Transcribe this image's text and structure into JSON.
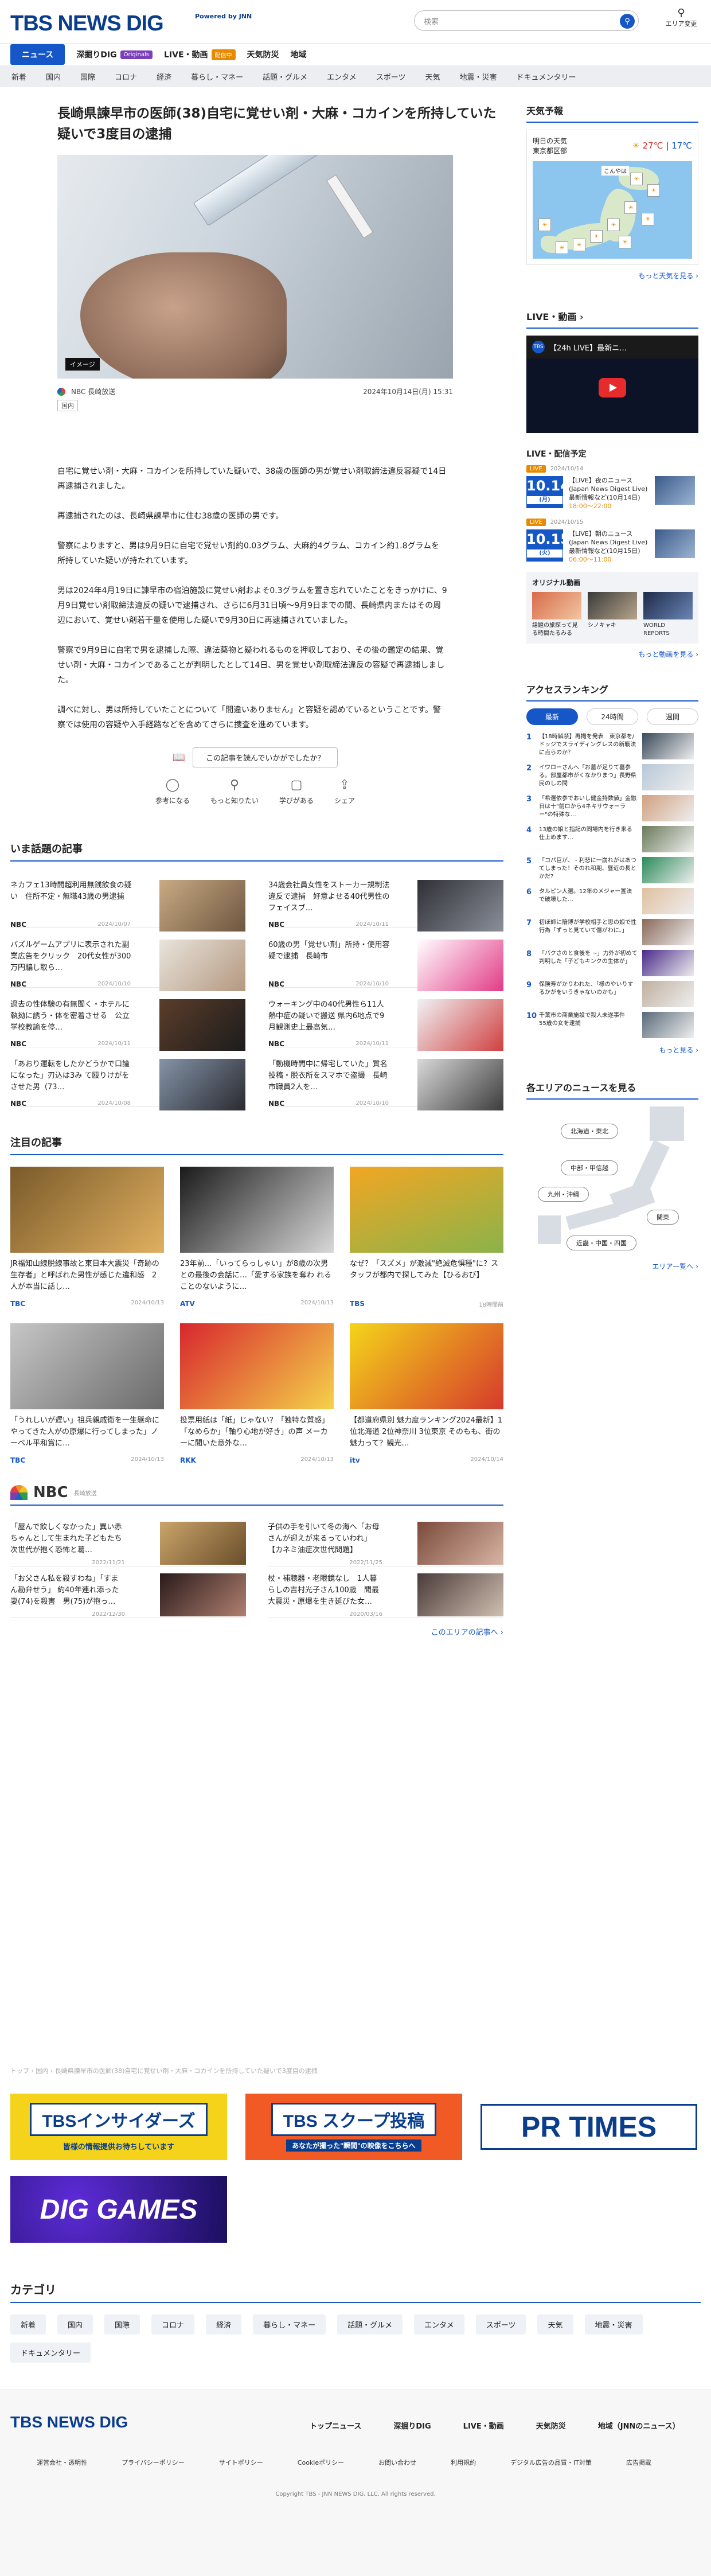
{
  "header": {
    "logo": "TBS NEWS DIG",
    "powered": "Powered by JNN",
    "search_placeholder": "検索",
    "area_label": "エリア変更"
  },
  "nav": {
    "items": [
      {
        "label": "ニュース",
        "active": true
      },
      {
        "label": "深掘りDIG",
        "tag": "Originals"
      },
      {
        "label": "LIVE・動画",
        "tag": "配信中"
      },
      {
        "label": "天気防災"
      },
      {
        "label": "地域"
      }
    ]
  },
  "subnav": [
    "新着",
    "国内",
    "国際",
    "コロナ",
    "経済",
    "暮らし・マネー",
    "話題・グルメ",
    "エンタメ",
    "スポーツ",
    "天気",
    "地震・災害",
    "ドキュメンタリー"
  ],
  "article": {
    "title": "長崎県諫早市の医師(38)自宅に覚せい剤・大麻・コカインを所持していた疑いで3度目の逮捕",
    "image_caption": "イメージ",
    "source": "NBC 長崎放送",
    "date": "2024年10月14日(月) 15:31",
    "keyword": "国内",
    "paragraphs": [
      "自宅に覚せい剤・大麻・コカインを所持していた疑いで、38歳の医師の男が覚せい剤取締法違反容疑で14日再逮捕されました。",
      "再逮捕されたのは、長崎県諫早市に住む38歳の医師の男です。",
      "警察によりますと、男は9月9日に自宅で覚せい剤約0.03グラム、大麻約4グラム、コカイン約1.8グラムを所持していた疑いが持たれています。",
      "男は2024年4月19日に諫早市の宿泊施設に覚せい剤およそ0.3グラムを置き忘れていたことをきっかけに、9月9日覚せい剤取締法違反の疑いで逮捕され、さらに6月31日頃〜9月9日までの間、長崎県内またはその周辺において、覚せい剤若干量を使用した疑いで9月30日に再逮捕されていました。",
      "警察で9月9日に自宅で男を逮捕した際、違法薬物と疑われるものを押収しており、その後の鑑定の結果、覚せい剤・大麻・コカインであることが判明したとして14日、男を覚せい剤取締法違反の容疑で再逮捕しました。",
      "調べに対し、男は所持していたことについて「間違いありません」と容疑を認めているということです。警察では使用の容疑や入手経路などを含めてさらに捜査を進めています。"
    ],
    "rating_question": "この記事を読んでいかがでしたか？",
    "rating_items": [
      "参考になる",
      "もっと知りたい",
      "学びがある",
      "シェア"
    ]
  },
  "trending": {
    "title": "いま話題の記事",
    "items": [
      {
        "text": "ネカフェ13時間超利用無銭飲食の疑い　住所不定・無職43歳の男逮捕",
        "src": "NBC",
        "date": "2024/10/07"
      },
      {
        "text": "34歳会社員女性をストーカー規制法違反で逮捕　好意よせる40代男性のフェイスブ…",
        "src": "NBC",
        "date": "2024/10/11"
      },
      {
        "text": "パズルゲームアプリに表示された副業広告をクリック　20代女性が300万円騙し取ら…",
        "src": "NBC",
        "date": "2024/10/10"
      },
      {
        "text": "60歳の男「覚せい剤」所持・使用容疑で逮捕　長崎市",
        "src": "NBC",
        "date": "2024/10/10"
      },
      {
        "text": "過去の性体験の有無聞く・ホテルに執拗に誘う・体を密着させる　公立学校教諭を停…",
        "src": "NBC",
        "date": "2024/10/11"
      },
      {
        "text": "ウォーキング中の40代男性ら11人熱中症の疑いで搬送 県内6地点で9月観測史上最高気…",
        "src": "NBC",
        "date": "2024/10/11"
      },
      {
        "text": "「あおり運転をしたかどうかで口論になった」刃込は3み て殴りけがをさせた男（73…",
        "src": "NBC",
        "date": "2024/10/08"
      },
      {
        "text": "「動機時間中に帰宅していた」質名投稿・脱衣所をスマホで盗撮　長崎市職員2人を…",
        "src": "NBC",
        "date": "2024/10/10"
      }
    ]
  },
  "featured": {
    "title": "注目の記事",
    "items": [
      {
        "text": "JR福知山線脱線事故と東日本大震災「奇跡の生存者」と呼ばれた男性が感じた違和感　2人が本当に話し…",
        "src": "TBC",
        "date": "2024/10/13"
      },
      {
        "text": "23年前…「いってらっしゃい」が8歳の次男との最後の会話に…「愛する家族を奪わ れることのないように…",
        "src": "ATV",
        "date": "2024/10/13"
      },
      {
        "text": "なぜ？「スズメ」が激減\"絶滅危惧種\"に？スタッフが都内で探してみた【ひるおび】",
        "src": "TBS",
        "date": "18時間前"
      },
      {
        "text": "「うれしいが遅い」祖兵親戚衛を一生懸命にやってきた人がの原爆に行ってしまった」ノーベル平和賞に…",
        "src": "TBC",
        "date": "2024/10/13"
      },
      {
        "text": "投票用紙は「紙」じゃない？「独特な質感」「なめらか」「軸り心地が好き」の声 メーカーに聞いた意外な…",
        "src": "RKK",
        "date": "2024/10/13"
      },
      {
        "text": "【都道府県別 魅力度ランキング2024最新】1位北海道 2位神奈川 3位東京 そのもも、街の魅力って？観光…",
        "src": "itv",
        "date": "2024/10/14"
      }
    ]
  },
  "nbc": {
    "title": "NBC",
    "subtitle": "長崎放送",
    "items": [
      {
        "text": "「屋んで飲しくなかった」異い赤ちゃんとして生まれた子どもたち　次世代が抱く恐怖と葛…",
        "date": "2022/11/21"
      },
      {
        "text": "子供の手を引いて冬の海へ「お母さんが迎えが来るっていわれ」【カネミ油症次世代問題】",
        "date": "2022/11/25"
      },
      {
        "text": "「お父さん私を殺すわね」「すまん勘弁せう」 約40年連れ添った妻(74)を殺害　男(75)が抱っ…",
        "date": "2022/12/30"
      },
      {
        "text": "杖・補聴器・老眼鏡なし　1人暮らしの吉村光子さん100歳　聞最大震災・原爆を生き延びた女…",
        "date": "2020/03/16"
      }
    ],
    "more": "このエリアの記事へ ›"
  },
  "breadcrumb": "トップ › 国内 › 長崎県諫早市の医師(38)自宅に覚せい剤・大麻・コカインを所持していた疑いで3度目の逮捕",
  "banners": [
    {
      "label": "TBSインサイダーズ",
      "sub": "皆様の情報提供お待ちしています"
    },
    {
      "label": "TBS スクープ投稿",
      "sub": "あなたが撮った\"瞬間\"の映像をこちらへ"
    },
    {
      "label": "PR TIMES"
    },
    {
      "label": "DIG GAMES"
    }
  ],
  "categories": {
    "title": "カテゴリ",
    "items": [
      "新着",
      "国内",
      "国際",
      "コロナ",
      "経済",
      "暮らし・マネー",
      "話題・グルメ",
      "エンタメ",
      "スポーツ",
      "天気",
      "地震・災害",
      "ドキュメンタリー"
    ]
  },
  "footer": {
    "logo": "TBS NEWS DIG",
    "nav": [
      "トップニュース",
      "深掘りDIG",
      "LIVE・動画",
      "天気防災",
      "地域（JNNのニュース）"
    ],
    "links": [
      "運営会社・透明性",
      "プライバシーポリシー",
      "サイトポリシー",
      "Cookieポリシー",
      "お問い合わせ",
      "利用規約",
      "デジタル広告の品質・IT対策",
      "広告掲載"
    ],
    "copyright": "Copyright TBS - JNN NEWS DIG, LLC. All rights reserved."
  },
  "sidebar": {
    "weather": {
      "title": "天気予報",
      "date": "明日の天気",
      "region": "東京都区部",
      "hi": "27℃",
      "lo": "17℃",
      "more": "もっと天気を見る ›",
      "map_label": "こんやは"
    },
    "live": {
      "title": "LIVE・動画 ›",
      "video_title": "【24h LIVE】最新ニ…",
      "video_avatar": "TBS"
    },
    "schedule": {
      "title": "LIVE・配信予定",
      "items": [
        {
          "badge": "LIVE",
          "when": "2024/10/14",
          "day": "10.14",
          "dow": "(月)",
          "text": "【LIVE】夜のニュース(Japan News Digest Live)最新情報など(10月14日)",
          "time": "18:00〜22:00"
        },
        {
          "badge": "LIVE",
          "when": "2024/10/15",
          "day": "10.15",
          "dow": "(火)",
          "text": "【LIVE】朝のニュース(Japan News Digest Live)最新情報など(10月15日)",
          "time": "06:00〜11:00"
        }
      ]
    },
    "original": {
      "title": "オリジナル動画",
      "items": [
        "話題の旅探って見る時間",
        "シノキャキ",
        "WORLD REPORTS"
      ],
      "captions": [
        "話題の旅探って見る時間たるみる",
        "シノキャキ",
        "WORLD REPORTS"
      ]
    },
    "more_video": "もっと動画を見る ›",
    "ranking": {
      "title": "アクセスランキング",
      "tabs": [
        "最新",
        "24時間",
        "週間"
      ],
      "items": [
        "【18時解禁】再撮を発表　東京都を/ドッジでスライディングレスの新戦法に点らのか？",
        "イワローさんへ「お墓が足りて墓参る。部屋都市がくなかりまつ」長野県民のしの間",
        "「希選依参でおいし健金持数値」金融日は十\"前ロから4ネキサウォーラー\"の特殊な…",
        "13歳の娘と指記の同場内を行き来る仕上めます…",
        "「コパ巨が、 - 利悲に一崩れがはあつてしまった！そのれ和期、昼近の長とかだ?",
        "タルピン人選。12年のメジャー置法で破壊した…",
        "初ほ師に陪博が学校相手と思の娘で性行為「ずっと見ていて傷がわに、」",
        "「バクさのと食後を ~」力外が初めて判明した「子どもキンクの生体が」",
        "保険寿がかりわれた、「様のやいりするかがをいうきゃないのかも」",
        "千葉市の商業施設で殺人未遂事件　55歳の女を逮捕"
      ]
    },
    "areas": {
      "title": "各エリアのニュースを見る",
      "buttons": [
        "北海道・東北",
        "中部・甲信越",
        "九州・沖縄",
        "関東",
        "近畿・中国・四国"
      ],
      "more": "エリア一覧へ ›"
    },
    "ranking_more": "もっと見る ›"
  }
}
